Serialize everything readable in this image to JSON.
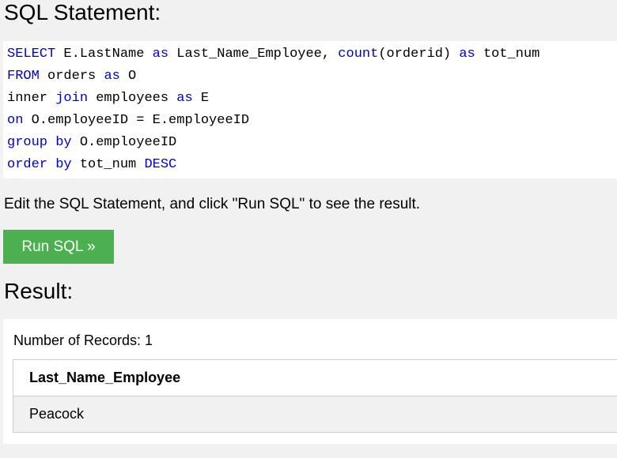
{
  "sql_heading": "SQL Statement:",
  "sql_lines": [
    [
      {
        "text": "SELECT",
        "kw": true
      },
      {
        "text": " E.LastName ",
        "kw": false
      },
      {
        "text": "as",
        "kw": true
      },
      {
        "text": " Last_Name_Employee, ",
        "kw": false
      },
      {
        "text": "count",
        "kw": true
      },
      {
        "text": "(orderid) ",
        "kw": false
      },
      {
        "text": "as",
        "kw": true
      },
      {
        "text": " tot_num",
        "kw": false
      }
    ],
    [
      {
        "text": "FROM",
        "kw": true
      },
      {
        "text": " orders ",
        "kw": false
      },
      {
        "text": "as",
        "kw": true
      },
      {
        "text": " O",
        "kw": false
      }
    ],
    [
      {
        "text": "inner ",
        "kw": false
      },
      {
        "text": "join",
        "kw": true
      },
      {
        "text": " employees ",
        "kw": false
      },
      {
        "text": "as",
        "kw": true
      },
      {
        "text": " E",
        "kw": false
      }
    ],
    [
      {
        "text": "on",
        "kw": true
      },
      {
        "text": " O.employeeID = E.employeeID",
        "kw": false
      }
    ],
    [
      {
        "text": "group by",
        "kw": true
      },
      {
        "text": " O.employeeID",
        "kw": false
      }
    ],
    [
      {
        "text": "order by",
        "kw": true
      },
      {
        "text": " tot_num ",
        "kw": false
      },
      {
        "text": "DESC",
        "kw": true
      }
    ]
  ],
  "instruction": "Edit the SQL Statement, and click \"Run SQL\" to see the result.",
  "run_button_label": "Run SQL »",
  "result_heading": "Result:",
  "result": {
    "record_count": "Number of Records: 1",
    "columns": [
      "Last_Name_Employee"
    ],
    "rows": [
      [
        "Peacock"
      ]
    ]
  },
  "colors": {
    "keyword": "#0000cd",
    "button": "#4caf50",
    "background": "#f1f1f1"
  }
}
